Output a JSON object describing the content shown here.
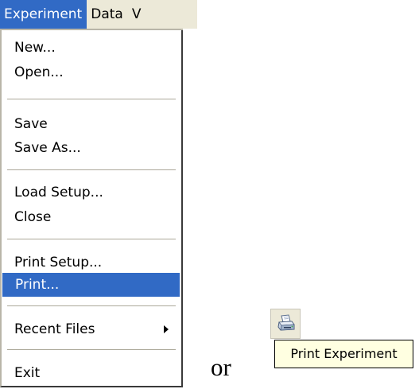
{
  "menubar": {
    "items": [
      {
        "label": "Experiment",
        "active": true
      },
      {
        "label": "Data",
        "active": false
      },
      {
        "label": "V",
        "active": false
      }
    ]
  },
  "menu": {
    "items": [
      {
        "label": "New..."
      },
      {
        "label": "Open..."
      },
      {
        "label": "Save"
      },
      {
        "label": "Save As..."
      },
      {
        "label": "Load Setup..."
      },
      {
        "label": "Close"
      },
      {
        "label": "Print Setup..."
      },
      {
        "label": "Print...",
        "highlighted": true
      },
      {
        "label": "Recent Files",
        "has_submenu": true
      },
      {
        "label": "Exit"
      }
    ]
  },
  "connector": {
    "text": "or"
  },
  "toolbar": {
    "print_button_icon": "printer-icon",
    "tooltip": "Print Experiment"
  },
  "colors": {
    "menu_highlight": "#316ac5",
    "menubar_background": "#ece9d8",
    "tooltip_background": "#ffffe1"
  }
}
